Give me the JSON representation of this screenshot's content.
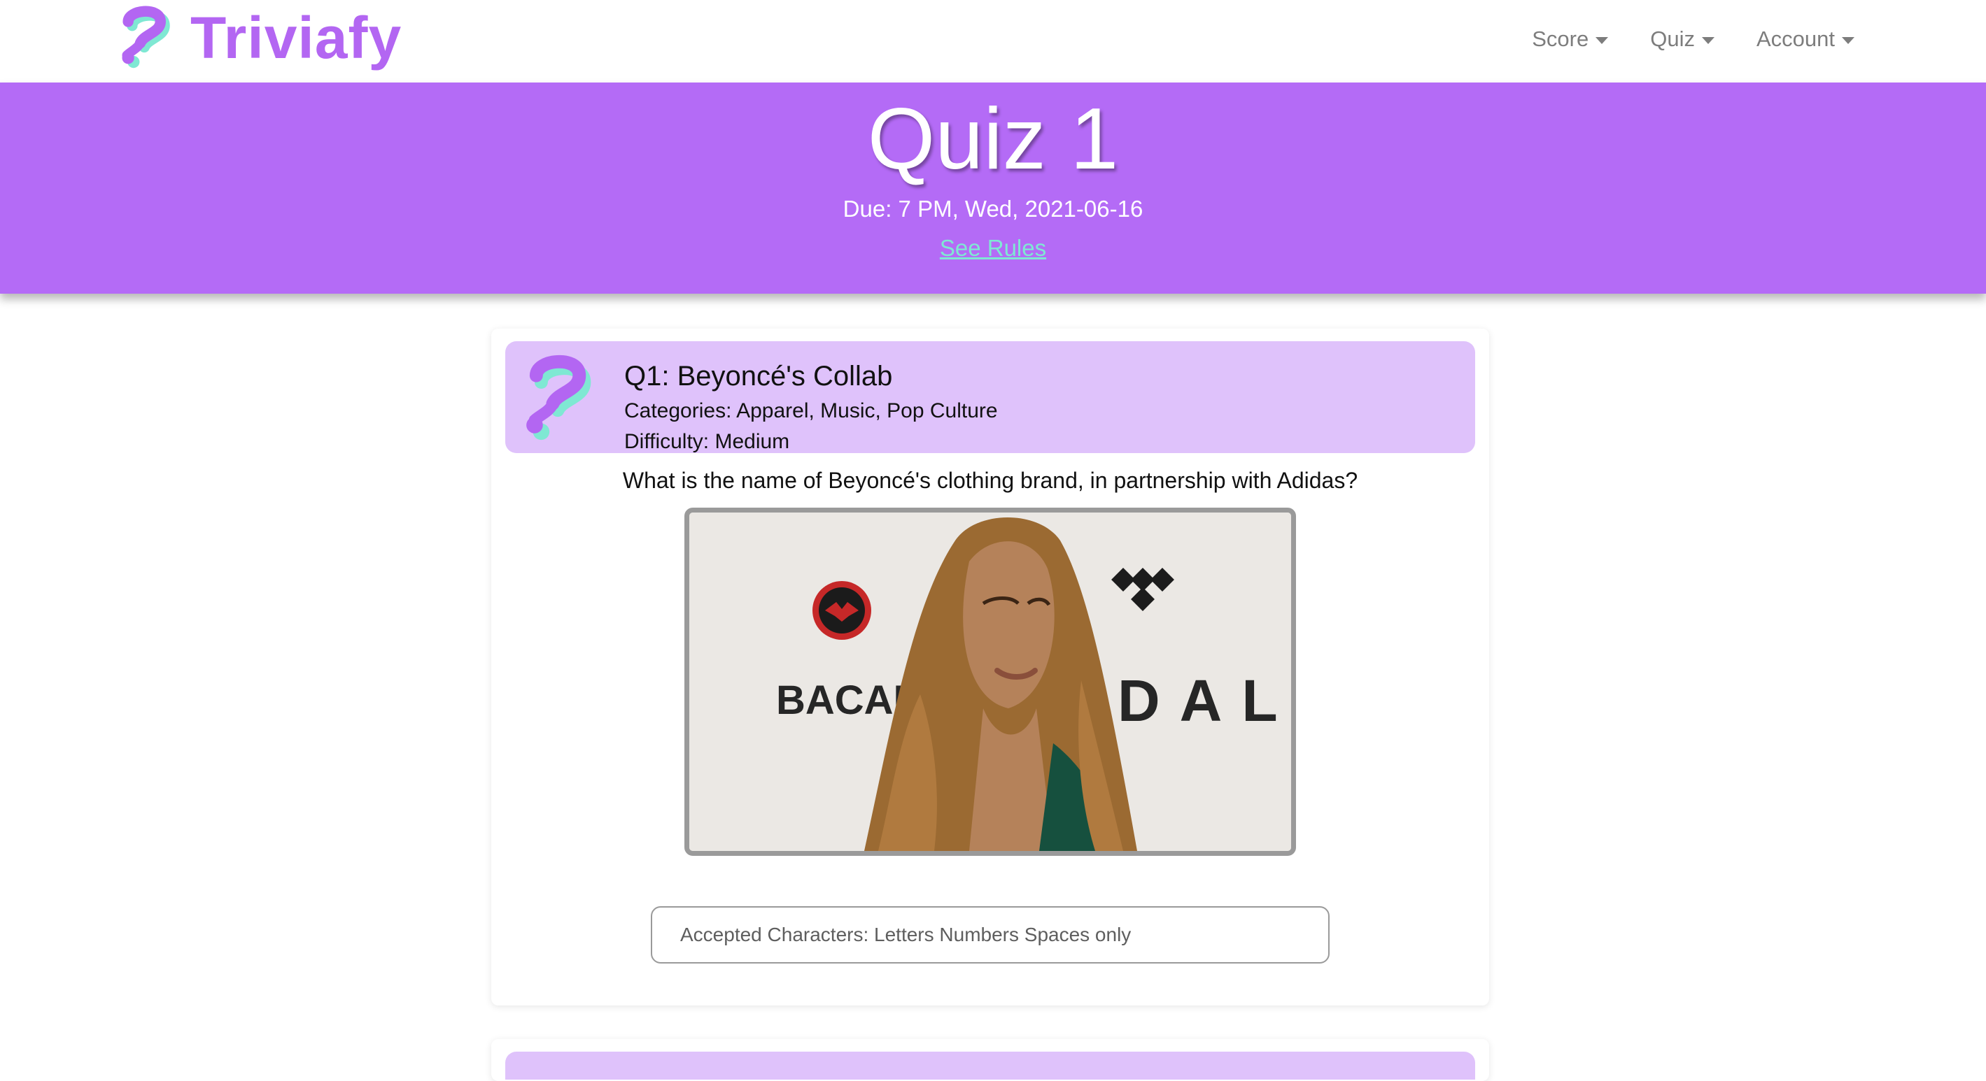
{
  "navbar": {
    "brand_name": "Triviafy",
    "menu": [
      {
        "label": "Score"
      },
      {
        "label": "Quiz"
      },
      {
        "label": "Account"
      }
    ]
  },
  "hero": {
    "title": "Quiz 1",
    "due": "Due: 7 PM, Wed, 2021-06-16",
    "rules_link": "See Rules"
  },
  "question": {
    "title": "Q1: Beyoncé's Collab",
    "categories": "Categories: Apparel, Music, Pop Culture",
    "difficulty": "Difficulty: Medium",
    "text": "What is the name of Beyoncé's clothing brand, in partnership with Adidas?",
    "image": {
      "backdrop_text_left": "BACAR",
      "backdrop_text_right": "DAL"
    },
    "answer_placeholder": "Accepted Characters: Letters Numbers Spaces only"
  },
  "colors": {
    "brand": "#b366f2",
    "hero_bg": "#b46bf6",
    "card_header_bg": "#dfc2fb",
    "link": "#7fe8d3",
    "logo_teal": "#7fe8d3"
  },
  "icons": {
    "brand_logo": "question-mark-logo-icon",
    "nav_caret": "caret-down-icon",
    "question_header": "question-mark-logo-icon"
  }
}
